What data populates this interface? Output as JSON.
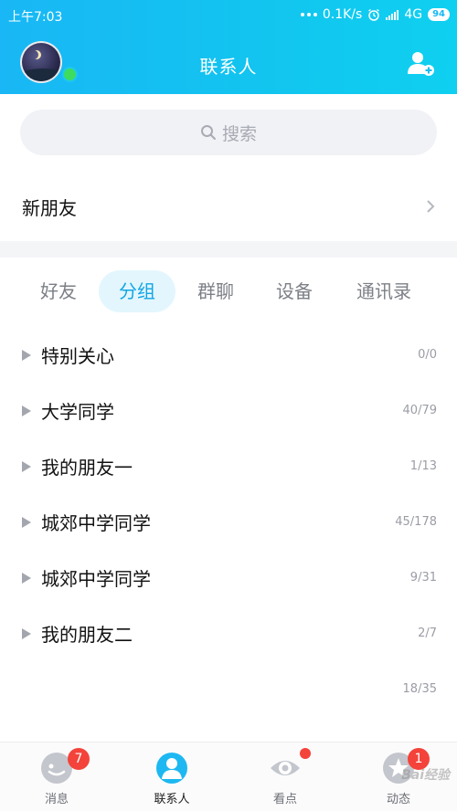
{
  "status_bar": {
    "time": "上午7:03",
    "speed": "0.1K/s",
    "network": "4G",
    "battery": "94"
  },
  "header": {
    "title": "联系人"
  },
  "search": {
    "placeholder": "搜索"
  },
  "new_friends": {
    "label": "新朋友"
  },
  "tabs": [
    {
      "label": "好友",
      "active": false
    },
    {
      "label": "分组",
      "active": true
    },
    {
      "label": "群聊",
      "active": false
    },
    {
      "label": "设备",
      "active": false
    },
    {
      "label": "通讯录",
      "active": false
    }
  ],
  "groups": [
    {
      "name": "特别关心",
      "count": "0/0"
    },
    {
      "name": "大学同学",
      "count": "40/79"
    },
    {
      "name": "我的朋友一",
      "count": "1/13"
    },
    {
      "name": "城郊中学同学",
      "count": "45/178"
    },
    {
      "name": "城郊中学同学",
      "count": "9/31"
    },
    {
      "name": "我的朋友二",
      "count": "2/7"
    },
    {
      "name": "",
      "count": "18/35"
    }
  ],
  "bottom_nav": {
    "items": [
      {
        "label": "消息",
        "badge": "7",
        "icon": "message-icon"
      },
      {
        "label": "联系人",
        "icon": "contacts-icon"
      },
      {
        "label": "看点",
        "icon": "eye-icon"
      },
      {
        "label": "动态",
        "badge": "1",
        "icon": "star-icon"
      }
    ]
  },
  "watermark": "Bai经验",
  "colors": {
    "header_start": "#19b7f5",
    "header_end": "#0fd0f0",
    "active_tab_text": "#12a6e4",
    "badge": "#f4433a",
    "online": "#3ddc5f"
  }
}
